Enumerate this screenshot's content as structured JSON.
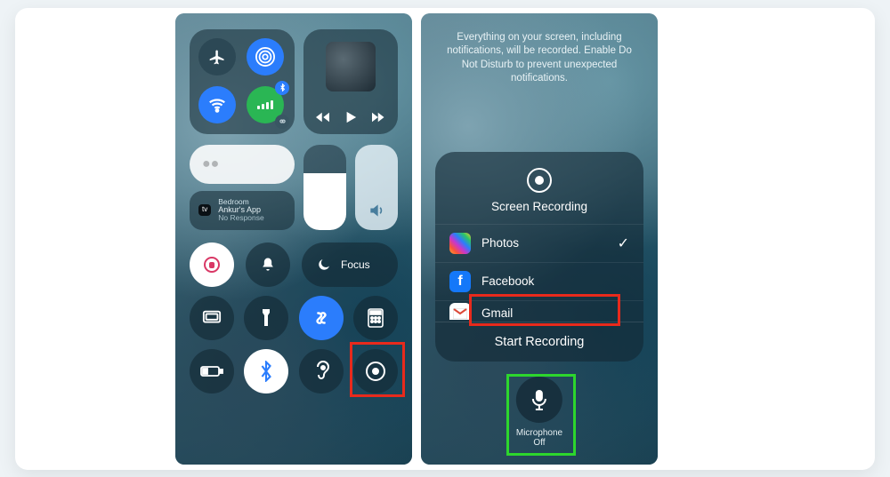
{
  "left": {
    "connectivity": {
      "airplane": "airplane-icon",
      "airdrop": "airdrop-icon",
      "wifi": "wifi-icon",
      "cellular": "cellular-icon",
      "bluetooth_small": "bluetooth-icon",
      "hotspot_small": "link-icon"
    },
    "appleTV": {
      "badge": "tv",
      "room": "Bedroom",
      "name": "Ankur's App",
      "status": "No Response"
    },
    "focus": {
      "label": "Focus"
    },
    "buttons": {
      "lock": "orientation-lock-icon",
      "silent": "bell-icon",
      "focus_label": "Focus",
      "mirroring": "screen-mirroring-icon",
      "flashlight": "flashlight-icon",
      "shazam": "shazam-icon",
      "calculator": "calculator-icon",
      "lowpower": "battery-icon",
      "bluetooth": "bluetooth-icon",
      "hearing": "ear-icon",
      "record": "record-icon"
    }
  },
  "right": {
    "notice": "Everything on your screen, including notifications, will be recorded. Enable Do Not Disturb to prevent unexpected notifications.",
    "title": "Screen Recording",
    "apps": [
      {
        "name": "Photos",
        "selected": true
      },
      {
        "name": "Facebook",
        "selected": false
      },
      {
        "name": "Gmail",
        "selected": false
      }
    ],
    "start": "Start Recording",
    "mic": {
      "label_line1": "Microphone",
      "label_line2": "Off"
    }
  }
}
